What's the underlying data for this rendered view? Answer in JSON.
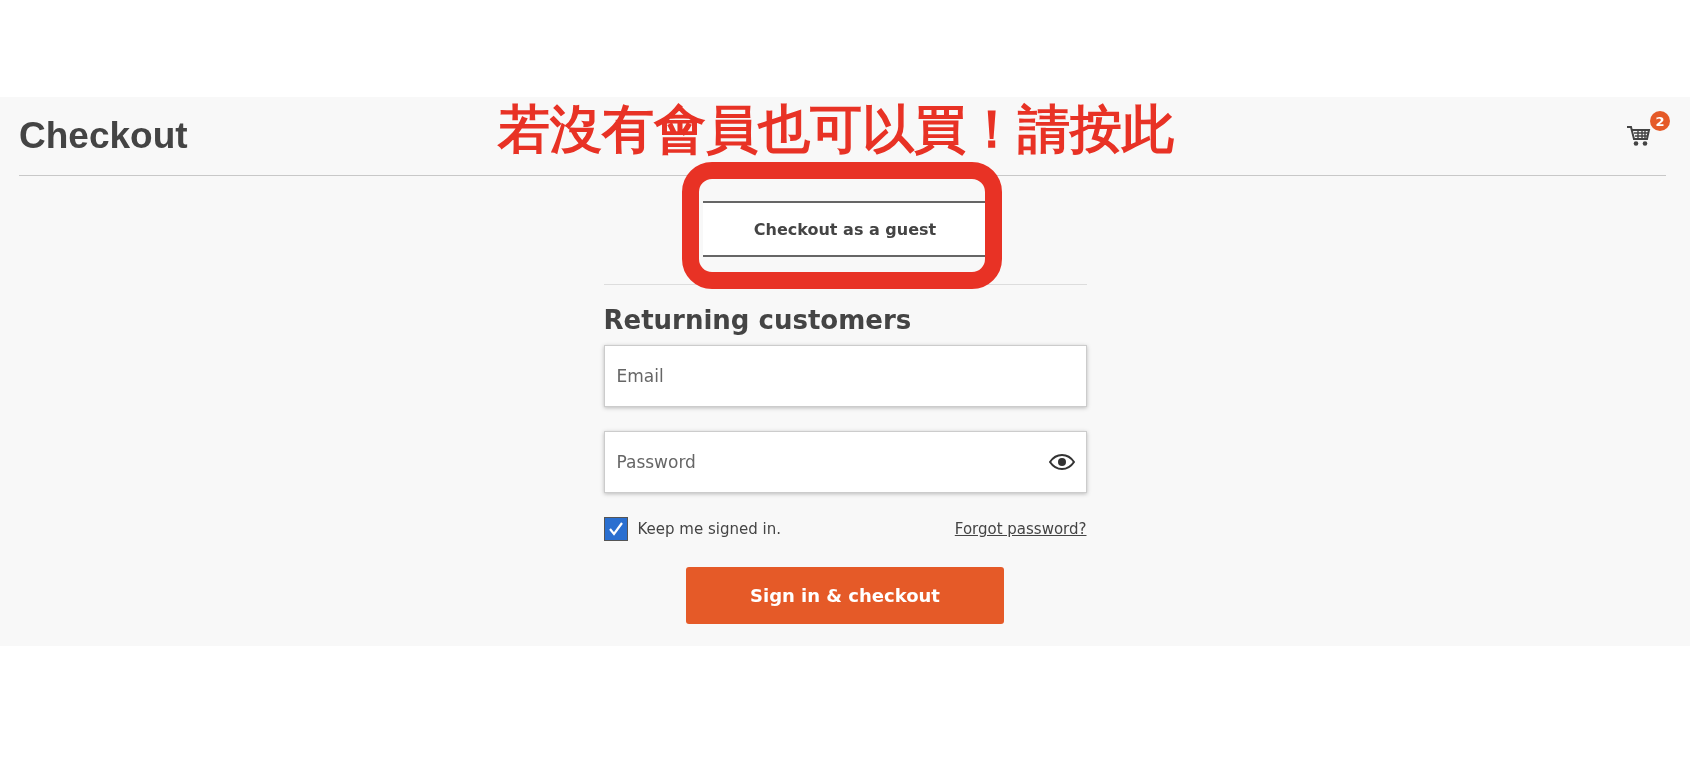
{
  "header": {
    "title": "Checkout",
    "cart_count": "2"
  },
  "annotation": {
    "text": "若沒有會員也可以買！請按此"
  },
  "guest_button": {
    "label": "Checkout as a guest"
  },
  "login": {
    "heading": "Returning customers",
    "fields": [
      {
        "kind": "text",
        "placeholder": "Email"
      },
      {
        "kind": "password",
        "placeholder": "Password"
      }
    ],
    "keep_signed_in": {
      "label": "Keep me signed in.",
      "checked": true
    },
    "forgot_link": "Forgot password?",
    "submit": "Sign in & checkout"
  }
}
